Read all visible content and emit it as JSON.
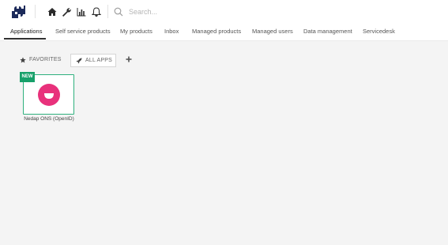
{
  "header": {
    "logo_icon": "puzzle-logo-icon",
    "search_placeholder": "Search...",
    "tools": [
      {
        "icon": "home-icon"
      },
      {
        "icon": "wrench-icon"
      },
      {
        "icon": "bar-chart-icon"
      },
      {
        "icon": "bell-icon"
      }
    ]
  },
  "tabs": [
    {
      "label": "Applications",
      "active": true
    },
    {
      "label": "Self service products"
    },
    {
      "label": "My products"
    },
    {
      "label": "Inbox"
    },
    {
      "label": "Managed products"
    },
    {
      "label": "Managed users"
    },
    {
      "label": "Data management"
    },
    {
      "label": "Servicedesk"
    }
  ],
  "filters": {
    "favorites_label": "FAVORITES",
    "all_apps_label": "ALL APPS"
  },
  "apps": [
    {
      "name": "Nedap ONS (OpenID)",
      "badge": "NEW",
      "logo_color": "#e8317b"
    }
  ],
  "colors": {
    "accent": "#2eb07d",
    "badge": "#17a06a",
    "logo_navy": "#1c2a5a"
  }
}
